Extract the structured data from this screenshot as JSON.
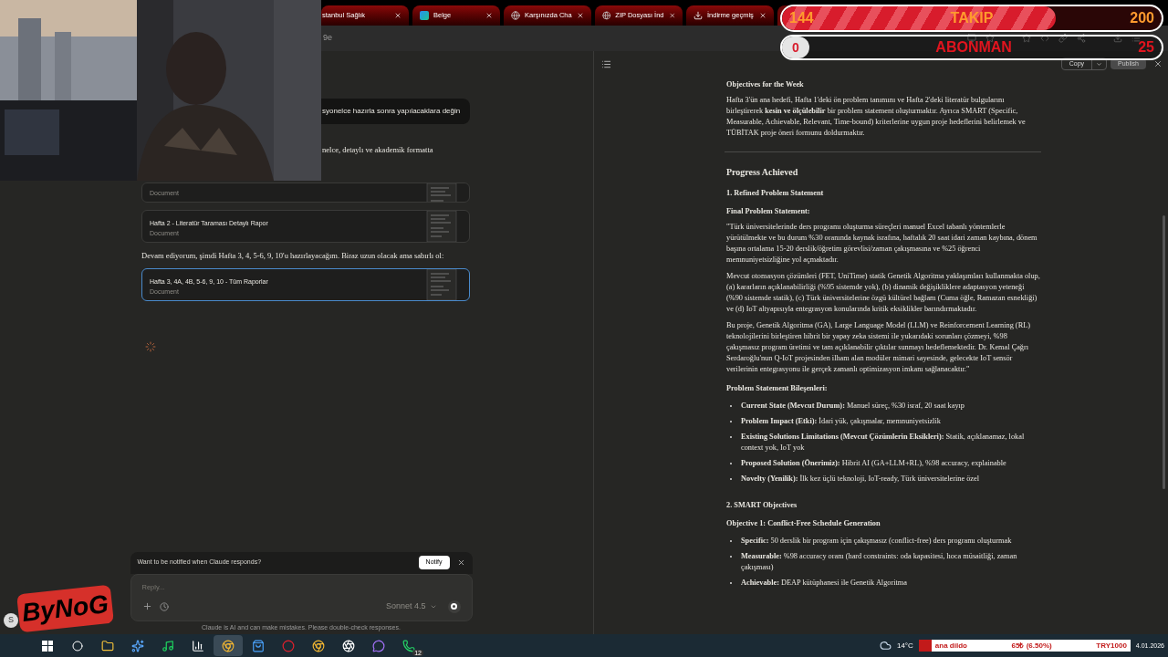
{
  "browser": {
    "tabs": [
      {
        "title": "stanbul Sağlık",
        "kind": "partial"
      },
      {
        "title": "Belge",
        "kind": "doc"
      },
      {
        "title": "Karşınızda Cha",
        "kind": "globe"
      },
      {
        "title": "ZIP Dosyası İnd",
        "kind": "globe"
      },
      {
        "title": "İndirme geçmiş",
        "kind": "download"
      }
    ],
    "address": "9e"
  },
  "stream_overlay": {
    "follow": {
      "current": "144",
      "label": "TAKIP",
      "goal": "200",
      "level": 0.72
    },
    "subscribe": {
      "current": "0",
      "label": "ABONMAN",
      "goal": "25",
      "level": 0
    }
  },
  "chat": {
    "items": [
      {
        "kind": "user",
        "text": "syonelce hazırla sonra yapılacaklara değin"
      },
      {
        "kind": "assistant",
        "text": "nelce, detaylı ve akademik formatta"
      },
      {
        "kind": "artifact",
        "subtitle": "Document",
        "selected": false
      },
      {
        "kind": "artifact",
        "title": "Hafta 2 - Literatür Taraması Detaylı Rapor",
        "subtitle": "Document",
        "selected": false
      },
      {
        "kind": "assistant",
        "text": "Devam ediyorum, şimdi Hafta 3, 4, 5-6, 9, 10'u hazırlayacağım. Biraz uzun olacak ama sabırlı ol:"
      },
      {
        "kind": "artifact",
        "title": "Hafta 3, 4A, 4B, 5-6, 9, 10 - Tüm Raporlar",
        "subtitle": "Document",
        "selected": true
      }
    ],
    "notify": {
      "text": "Want to be notified when Claude responds?",
      "button": "Notify"
    },
    "composer": {
      "placeholder": "Reply...",
      "model": "Sonnet 4.5"
    },
    "disclaimer": "Claude is AI and can make mistakes. Please double-check responses."
  },
  "artifact_view": {
    "copy": "Copy",
    "publish": {
      "label": "Publish",
      "disabled": true
    },
    "blocks": [
      {
        "kind": "h3",
        "text": "Objectives for the Week"
      },
      {
        "kind": "p",
        "text": "Hafta 3'ün ana hedefi, Hafta 1'deki ön problem tanımını ve Hafta 2'deki literatür bulgularını birleştirerek **kesin ve ölçülebilir** bir problem statement oluşturmaktır. Ayrıca SMART (Specific, Measurable, Achievable, Relevant, Time-bound) kriterlerine uygun proje hedeflerini belirlemek ve TÜBİTAK proje öneri formunu doldurmaktır."
      },
      {
        "kind": "hr"
      },
      {
        "kind": "h2",
        "text": "Progress Achieved"
      },
      {
        "kind": "h3",
        "text": "1. Refined Problem Statement"
      },
      {
        "kind": "h3",
        "text": "Final Problem Statement:"
      },
      {
        "kind": "p",
        "text": "\"Türk üniversitelerinde ders programı oluşturma süreçleri manuel Excel tabanlı yöntemlerle yürütülmekte ve bu durum %30 oranında kaynak israfına, haftalık 20 saat idari zaman kaybına, dönem başına ortalama 15-20 derslik/öğretim görevlisi/zaman çakışmasına ve %25 öğrenci memnuniyetsizliğine yol açmaktadır."
      },
      {
        "kind": "p",
        "text": "Mevcut otomasyon çözümleri (FET, UniTime) statik Genetik Algoritma yaklaşımları kullanmakta olup, (a) kararların açıklanabilirliği (%95 sistemde yok), (b) dinamik değişikliklere adaptasyon yeteneği (%90 sistemde statik), (c) Türk üniversitelerine özgü kültürel bağlam (Cuma öğle, Ramazan esnekliği) ve (d) IoT altyapısıyla entegrasyon konularında kritik eksiklikler barındırmaktadır."
      },
      {
        "kind": "p",
        "text": "Bu proje, Genetik Algoritma (GA), Large Language Model (LLM) ve Reinforcement Learning (RL) teknolojilerini birleştiren hibrit bir yapay zeka sistemi ile yukarıdaki sorunları çözmeyi, %98 çakışmasız program üretimi ve tam açıklanabilir çıktılar sunmayı hedeflemektedir. Dr. Kemal Çağrı Serdaroğlu'nun Q-IoT projesinden ilham alan modüler mimari sayesinde, gelecekte IoT sensör verilerinin entegrasyonu ile gerçek zamanlı optimizasyon imkanı sağlanacaktır.\""
      },
      {
        "kind": "h3",
        "text": "Problem Statement Bileşenleri:"
      },
      {
        "kind": "ul",
        "items": [
          "**Current State (Mevcut Durum):** Manuel süreç, %30 israf, 20 saat kayıp",
          "**Problem Impact (Etki):** İdari yük, çakışmalar, memnuniyetsizlik",
          "**Existing Solutions Limitations (Mevcut Çözümlerin Eksikleri):** Statik, açıklanamaz, lokal context yok, IoT yok",
          "**Proposed Solution (Önerimiz):** Hibrit AI (GA+LLM+RL), %98 accuracy, explainable",
          "**Novelty (Yenilik):** İlk kez üçlü teknoloji, IoT-ready, Türk üniversitelerine özel"
        ]
      },
      {
        "kind": "h3",
        "text": "2. SMART Objectives"
      },
      {
        "kind": "h3",
        "text": "Objective 1: Conflict-Free Schedule Generation"
      },
      {
        "kind": "ul",
        "items": [
          "**Specific:** 50 derslik bir program için çakışmasız (conflict-free) ders programı oluşturmak",
          "**Measurable:** %98 accuracy oranı (hard constraints: oda kapasitesi, hoca müsaitliği, zaman çakışması)",
          "**Achievable:** DEAP kütüphanesi ile Genetik Algoritma"
        ]
      }
    ]
  },
  "logo": {
    "text": "ByNoG",
    "avatar": "S"
  },
  "taskbar": {
    "apps": [
      {
        "kind": "start",
        "selected": false
      },
      {
        "kind": "search",
        "selected": false
      },
      {
        "kind": "folder",
        "selected": false
      },
      {
        "kind": "sparkle",
        "selected": false
      },
      {
        "kind": "music",
        "selected": false
      },
      {
        "kind": "chart",
        "selected": false
      },
      {
        "kind": "browser",
        "selected": true
      },
      {
        "kind": "store",
        "selected": false
      },
      {
        "kind": "ring",
        "selected": false
      },
      {
        "kind": "browser",
        "selected": false
      },
      {
        "kind": "aperture",
        "selected": false
      },
      {
        "kind": "chat",
        "selected": false
      },
      {
        "kind": "phone",
        "selected": false,
        "badge": "12"
      }
    ],
    "weather": "14°C",
    "ticker": {
      "name": "ana dildo",
      "change": "65₺ (6.50%)",
      "target": "TRY1000"
    },
    "date": "4.01.2026"
  }
}
